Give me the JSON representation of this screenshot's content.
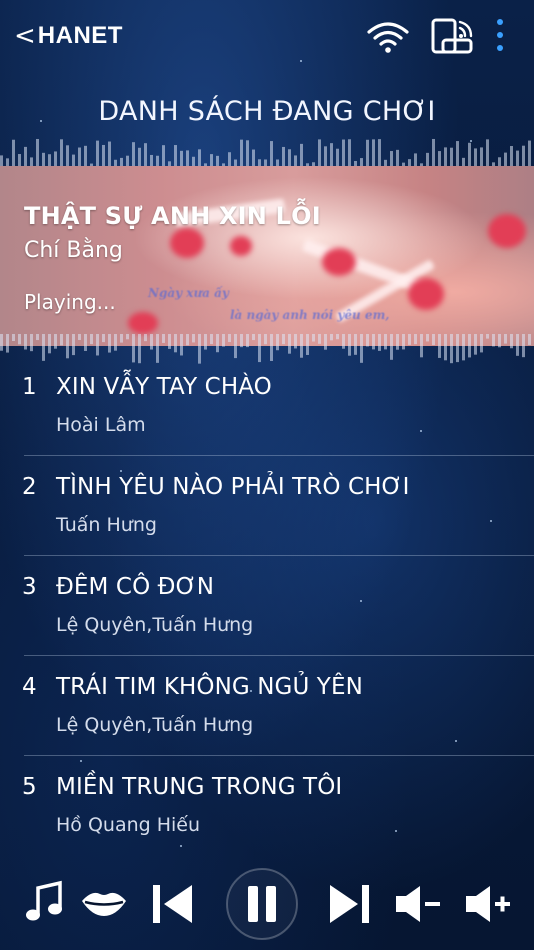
{
  "header": {
    "back_glyph": "<",
    "logo": "HANET",
    "icons": [
      "wifi-icon",
      "device-remote-icon",
      "more-vertical-icon"
    ]
  },
  "page_title": "DANH SÁCH ĐANG CHƠI",
  "now_playing": {
    "title": "THẬT SỰ ANH XIN LỖI",
    "artist": "Chí Bằng",
    "status": "Playing...",
    "lyric_line_1": "Ngày xưa ấy",
    "lyric_line_2": "là ngày anh nói yêu em,"
  },
  "playlist": [
    {
      "index": "1",
      "title": "XIN VẪY TAY CHÀO",
      "artist": "Hoài Lâm"
    },
    {
      "index": "2",
      "title": "TÌNH YÊU NÀO PHẢI TRÒ CHƠI",
      "artist": "Tuấn Hưng"
    },
    {
      "index": "3",
      "title": "ĐÊM CÔ ĐƠN",
      "artist": "Lệ Quyên,Tuấn Hưng"
    },
    {
      "index": "4",
      "title": "TRÁI TIM KHÔNG NGỦ YÊN",
      "artist": "Lệ Quyên,Tuấn Hưng"
    },
    {
      "index": "5",
      "title": "MIỀN TRUNG TRONG TÔI",
      "artist": "Hồ Quang Hiếu"
    }
  ],
  "controls": [
    "music-note-icon",
    "lips-icon",
    "previous-icon",
    "pause-icon",
    "next-icon",
    "volume-down-icon",
    "volume-up-icon"
  ],
  "colors": {
    "background": "#081a3a",
    "text": "#ffffff",
    "secondary_text": "#d4dceb",
    "accent_blue": "#3aa0ff"
  }
}
